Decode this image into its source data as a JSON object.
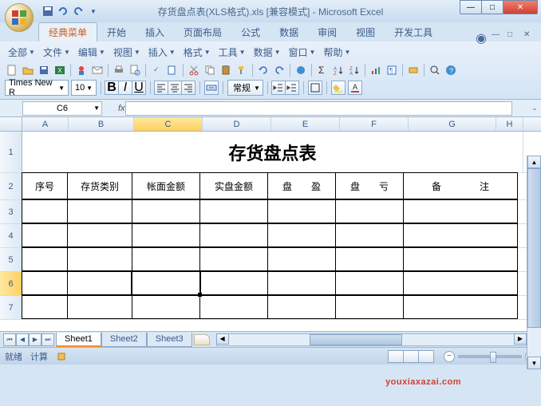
{
  "window": {
    "title": "存货盘点表(XLS格式).xls  [兼容模式] - Microsoft Excel",
    "min": "—",
    "max": "□",
    "close": "✕"
  },
  "tabs": {
    "classic": "经典菜单",
    "home": "开始",
    "insert": "插入",
    "layout": "页面布局",
    "formula": "公式",
    "data": "数据",
    "review": "审阅",
    "view": "视图",
    "dev": "开发工具"
  },
  "menus": {
    "all": "全部",
    "file": "文件",
    "edit": "编辑",
    "view": "视图",
    "insert": "插入",
    "format": "格式",
    "tools": "工具",
    "data": "数据",
    "window": "窗口",
    "help": "帮助"
  },
  "font": {
    "name": "Times New R",
    "size": "10",
    "style_label": "常规"
  },
  "namebox": "C6",
  "columns": [
    "A",
    "B",
    "C",
    "D",
    "E",
    "F",
    "G",
    "H"
  ],
  "sheet": {
    "title": "存货盘点表",
    "headers": {
      "A": "序号",
      "B": "存货类别",
      "C": "帐面金额",
      "D": "实盘金额",
      "E": "盘　　盈",
      "F": "盘　　亏",
      "G": "备　　　　注"
    }
  },
  "sheets": {
    "s1": "Sheet1",
    "s2": "Sheet2",
    "s3": "Sheet3"
  },
  "status": {
    "ready": "就绪",
    "calc": "计算"
  },
  "watermark": "youxiaxazai.com"
}
